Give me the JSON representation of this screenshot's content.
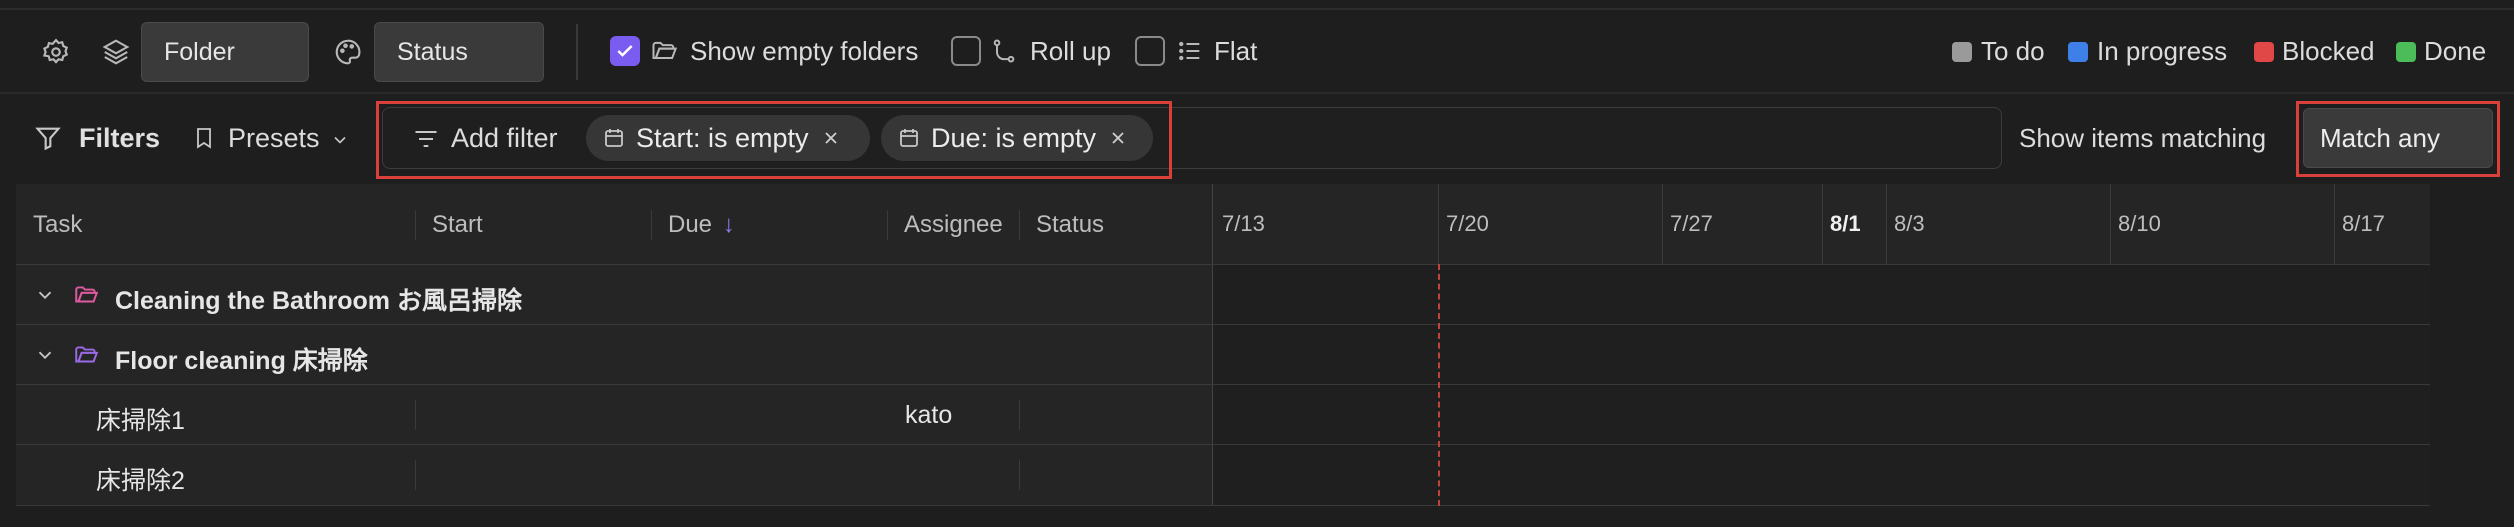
{
  "toolbar": {
    "folder_label": "Folder",
    "status_label": "Status",
    "show_empty_folders": "Show empty folders",
    "show_empty_folders_checked": true,
    "roll_up": "Roll up",
    "roll_up_checked": false,
    "flat": "Flat",
    "flat_checked": false,
    "legend": [
      {
        "label": "To do",
        "color": "#9a9a9a"
      },
      {
        "label": "In progress",
        "color": "#3f7fe8"
      },
      {
        "label": "Blocked",
        "color": "#e04848"
      },
      {
        "label": "Done",
        "color": "#4cbb5a"
      }
    ]
  },
  "filters": {
    "title": "Filters",
    "presets": "Presets",
    "add_filter": "Add filter",
    "chips": [
      {
        "label": "Start: is empty"
      },
      {
        "label": "Due: is empty"
      }
    ],
    "show_items_matching": "Show items matching",
    "match_mode": "Match any"
  },
  "table": {
    "columns": {
      "task": "Task",
      "start": "Start",
      "due": "Due",
      "assignee": "Assignee",
      "status": "Status"
    },
    "dates": [
      "7/13",
      "7/20",
      "7/27",
      "8/1",
      "8/3",
      "8/10",
      "8/17"
    ],
    "folders": [
      {
        "name": "Cleaning the Bathroom お風呂掃除",
        "icon_color": "#e05aa0"
      },
      {
        "name": "Floor cleaning 床掃除",
        "icon_color": "#9a6ae6"
      }
    ],
    "rows": [
      {
        "task": "床掃除1",
        "start": "",
        "due": "",
        "assignee": "kato",
        "status": ""
      },
      {
        "task": "床掃除2",
        "start": "",
        "due": "",
        "assignee": "",
        "status": ""
      }
    ]
  },
  "colors": {
    "accent": "#7b5cf0",
    "highlight": "#d9403a",
    "today_line": "#c0443e"
  }
}
